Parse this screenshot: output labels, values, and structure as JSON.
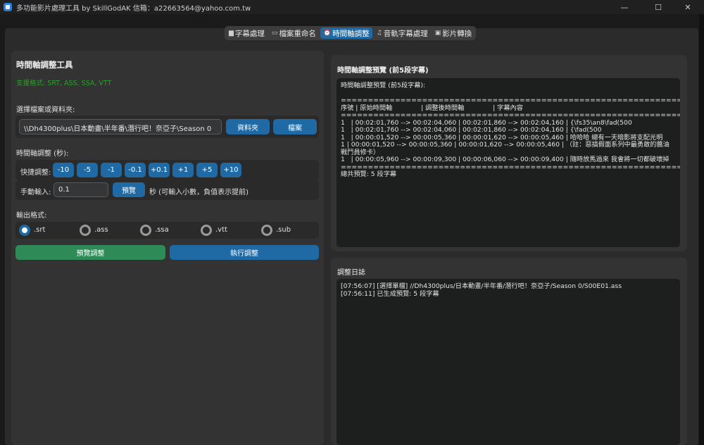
{
  "window": {
    "title": "多功能影片處理工具 by SkillGodAK  信箱：a22663564@yahoo.com.tw",
    "minimize": "—",
    "maximize": "☐",
    "close": "✕"
  },
  "tabs": [
    {
      "icon": "▆",
      "label": "字幕處理"
    },
    {
      "icon": "▭",
      "label": "檔案重命名"
    },
    {
      "icon": "⏰",
      "label": "時間軸調整"
    },
    {
      "icon": "♫",
      "label": "音軌字幕處理"
    },
    {
      "icon": "▣",
      "label": "影片轉換"
    }
  ],
  "left": {
    "title": "時間軸調整工具",
    "supported_formats": "支援格式: SRT, ASS, SSA, VTT",
    "select_label": "選擇檔案或資料夾:",
    "path_value": "\\\\Dh4300plus\\日本動畫\\半年番\\潛行吧！奈亞子\\Season 0",
    "folder_button": "資料夾",
    "file_button": "檔案",
    "adjust_label": "時間軸調整 (秒):",
    "quick_label": "快捷調整:",
    "quick_buttons": [
      "-10",
      "-5",
      "-1",
      "-0.1",
      "+0.1",
      "+1",
      "+5",
      "+10"
    ],
    "manual_label": "手動輸入:",
    "manual_value": "0.1",
    "preview_small": "預覽",
    "manual_hint": "秒 (可輸入小數，負值表示提前)",
    "output_label": "輸出格式:",
    "formats": [
      ".srt",
      ".ass",
      ".ssa",
      ".vtt",
      ".sub"
    ],
    "selected_format": ".srt",
    "preview_button": "預覽調整",
    "execute_button": "執行調整"
  },
  "preview": {
    "panel_title": "時間軸調整預覽 (前5段字幕)",
    "heading": "時間軸調整預覽 (前5段字幕):",
    "separator": "==============================================================================",
    "columns_header": "序號 | 原始時間軸              | 調整後時間軸              | 字幕內容",
    "rows": [
      "1   | 00:02:01,760 --> 00:02:04,060 | 00:02:01,860 --> 00:02:04,160 | {\\fs35\\an8\\fad(500",
      "1   | 00:02:01,760 --> 00:02:04,060 | 00:02:01,860 --> 00:02:04,160 | {\\fad(500",
      "1   | 00:00:01,520 --> 00:00:05,360 | 00:00:01,620 --> 00:00:05,460 | 哈哈哈 總有一天暗影將支配光明",
      "1   | 00:00:01,520 --> 00:00:05,360 | 00:00:01,620 --> 00:00:05,460 | （註：惡搞假面系列中最勇敢的醬油 戰鬥員修卡）",
      "1   | 00:00:05,960 --> 00:00:09,300 | 00:00:06,060 --> 00:00:09,400 | 隨時放馬過來 我會將一切都破壞掉"
    ],
    "total": "總共預覽: 5 段字幕"
  },
  "log": {
    "title": "調整日誌",
    "lines": [
      "[07:56:07] [選擇單檔] //Dh4300plus/日本動畫/半年番/潛行吧！奈亞子/Season 0/S00E01.ass",
      "[07:56:11] 已生成預覽: 5 段字幕"
    ]
  },
  "colors": {
    "accent": "#1f6aa5",
    "success": "#2e8b57",
    "formats_text": "#2aa02a"
  }
}
